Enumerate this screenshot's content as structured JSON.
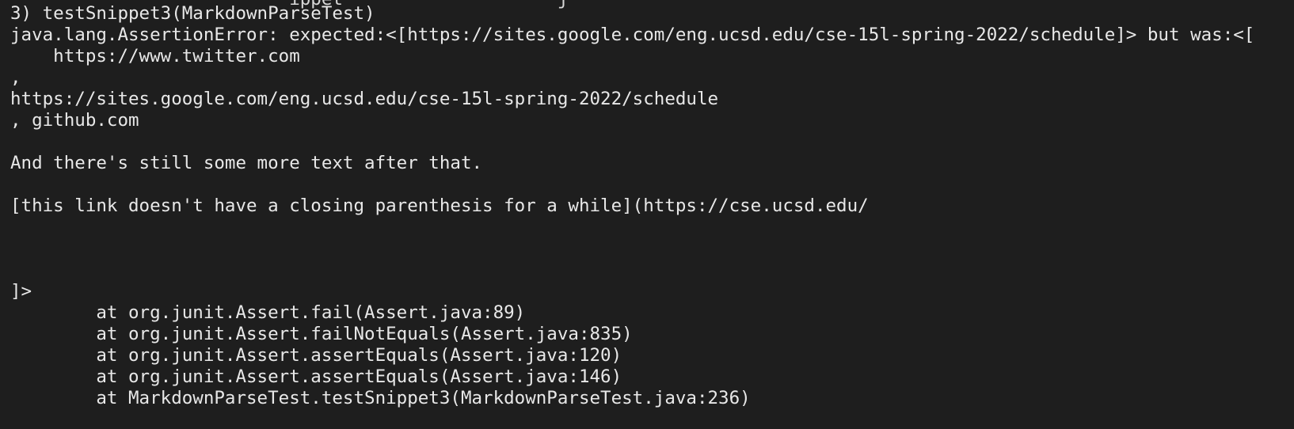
{
  "terminal": {
    "background": "#1e1e1e",
    "foreground": "#e8e8e8",
    "lines": [
      "                          ippet                    j",
      "3) testSnippet3(MarkdownParseTest)",
      "java.lang.AssertionError: expected:<[https://sites.google.com/eng.ucsd.edu/cse-15l-spring-2022/schedule]> but was:<[",
      "    https://www.twitter.com",
      ",",
      "https://sites.google.com/eng.ucsd.edu/cse-15l-spring-2022/schedule",
      ", github.com",
      "",
      "And there's still some more text after that.",
      "",
      "[this link doesn't have a closing parenthesis for a while](https://cse.ucsd.edu/",
      "",
      "",
      "",
      "]>",
      "        at org.junit.Assert.fail(Assert.java:89)",
      "        at org.junit.Assert.failNotEquals(Assert.java:835)",
      "        at org.junit.Assert.assertEquals(Assert.java:120)",
      "        at org.junit.Assert.assertEquals(Assert.java:146)",
      "        at MarkdownParseTest.testSnippet3(MarkdownParseTest.java:236)"
    ]
  }
}
